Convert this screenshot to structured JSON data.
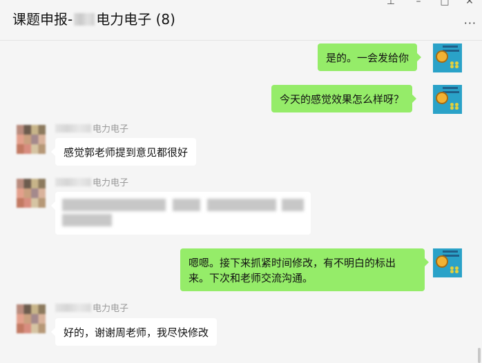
{
  "header": {
    "title_prefix": "课题申报-",
    "title_suffix": "电力电子 (8)",
    "pin_icon": "pin-icon",
    "minimize_icon": "minimize-icon",
    "maximize_icon": "maximize-icon",
    "close_icon": "close-icon",
    "more_label": "···"
  },
  "messages": [
    {
      "from": "self",
      "text": "是的。一会发给你"
    },
    {
      "from": "self",
      "text": "今天的感觉效果怎么样呀？"
    },
    {
      "from": "other",
      "sender": "电力电子",
      "text": "感觉郭老师提到意见都很好"
    },
    {
      "from": "other",
      "sender": "电力电子",
      "text": ""
    },
    {
      "from": "self",
      "text": "嗯嗯。接下来抓紧时间修改，有不明白的标出来。下次和老师交流沟通。",
      "line1": "嗯嗯。接下来抓紧时间修改，有不明白的标出",
      "line2": "来。下次和老师交流沟通。"
    },
    {
      "from": "other",
      "sender": "电力电子",
      "text": "好的，谢谢周老师，我尽快修改"
    }
  ],
  "colors": {
    "self_bubble": "#95ec69",
    "other_bubble": "#ffffff",
    "background": "#f5f5f5"
  }
}
